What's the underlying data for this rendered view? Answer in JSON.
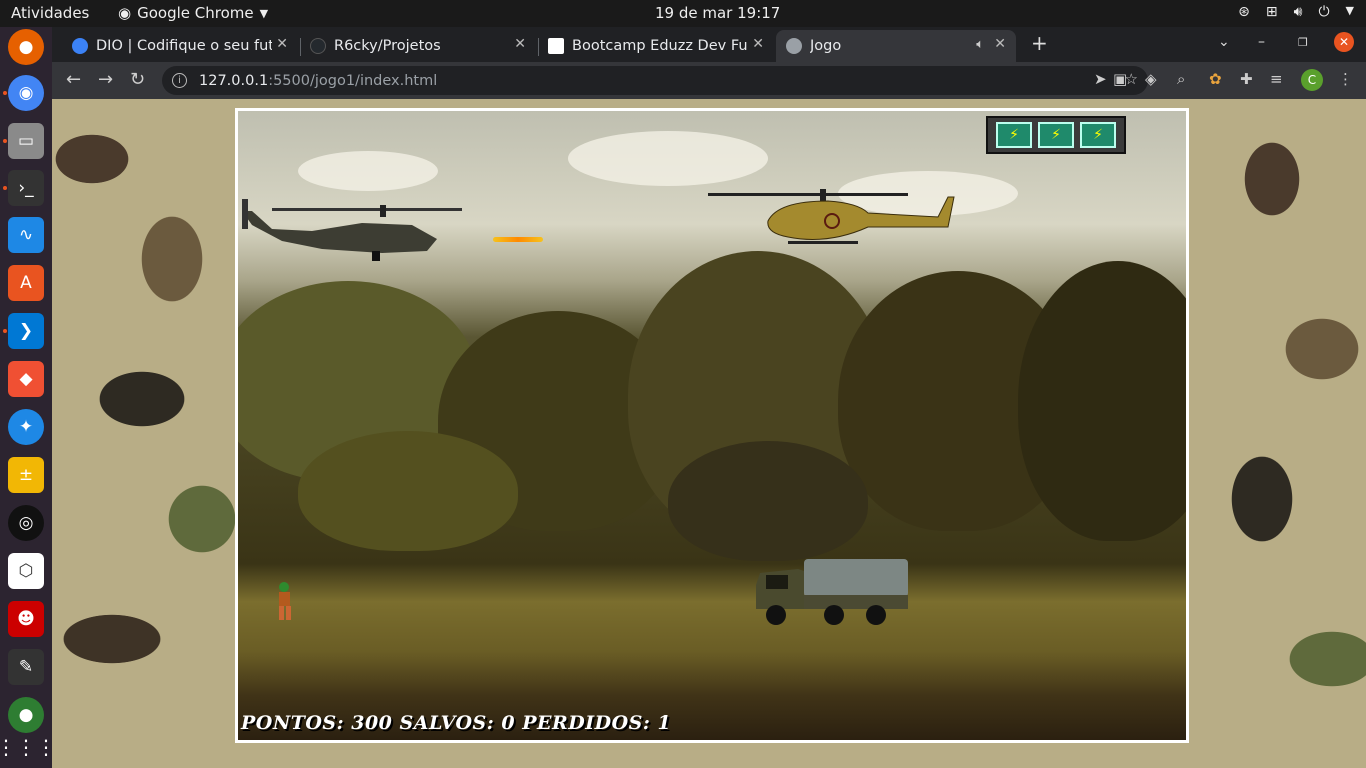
{
  "topbar": {
    "activities": "Atividades",
    "app_name": "Google Chrome",
    "clock": "19 de mar  19:17"
  },
  "tabs": [
    {
      "title": "DIO | Codifique o seu futu",
      "favicon_color": "#3b82f6"
    },
    {
      "title": "R6cky/Projetos",
      "favicon_color": "#24292e"
    },
    {
      "title": "Bootcamp Eduzz Dev Fullt",
      "favicon_color": "#ffffff"
    },
    {
      "title": "Jogo",
      "favicon_color": "#9aa0a6"
    }
  ],
  "address": {
    "host": "127.0.0.1",
    "path": ":5500/jogo1/index.html"
  },
  "profile": {
    "initial": "C"
  },
  "game": {
    "score_text": "PONTOS: 300 SALVOS: 0 PERDIDOS: 1",
    "lives": 3,
    "colors": {
      "frame": "#ffffff",
      "life_box": "#1f8a6b"
    }
  }
}
